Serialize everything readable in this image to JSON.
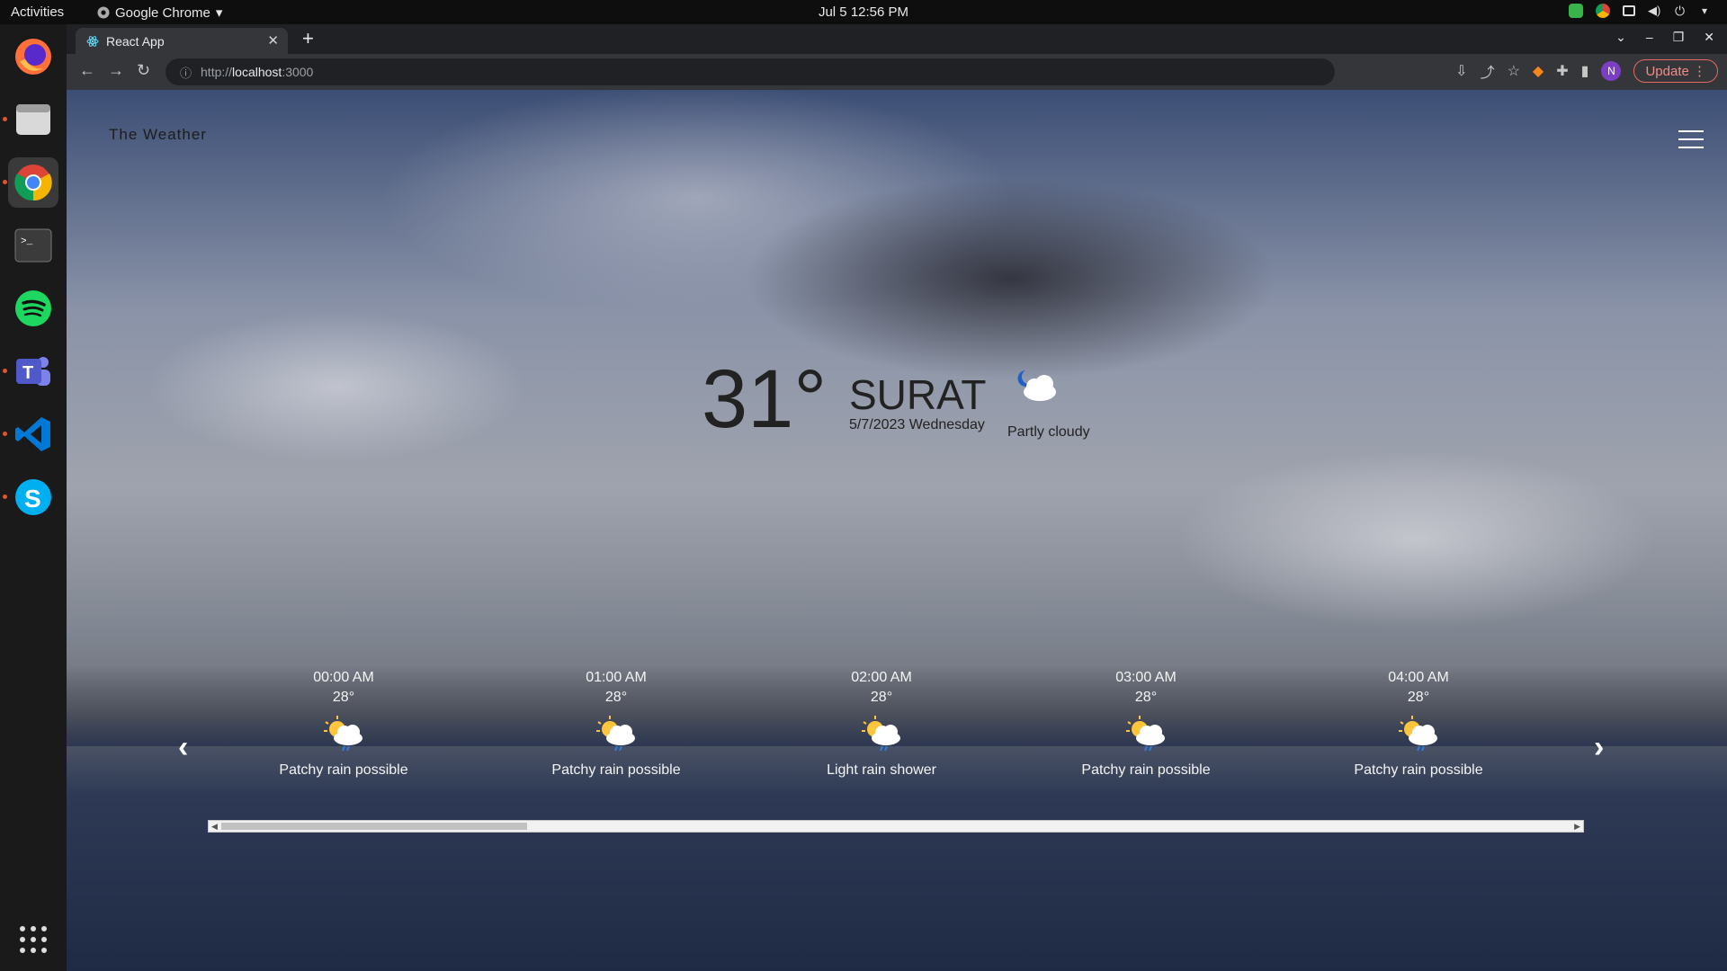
{
  "topbar": {
    "activities": "Activities",
    "app_name": "Google Chrome",
    "clock": "Jul 5  12:56 PM"
  },
  "dock": {
    "items": [
      "firefox-icon",
      "files-icon",
      "chrome-icon",
      "terminal-icon",
      "spotify-icon",
      "teams-icon",
      "vscode-icon",
      "skype-icon",
      "app-grid-icon"
    ]
  },
  "browser": {
    "tab_title": "React App",
    "url_prefix": "http://",
    "url_host": "localhost",
    "url_port": ":3000",
    "update_label": "Update",
    "avatar_letter": "N"
  },
  "app": {
    "logo": "The Weather",
    "current": {
      "temperature": "31°",
      "city": "SURAT",
      "date": "5/7/2023 Wednesday",
      "condition": "Partly cloudy"
    },
    "hourly": [
      {
        "time": "00:00 AM",
        "temp": "28°",
        "desc": "Patchy rain possible"
      },
      {
        "time": "01:00 AM",
        "temp": "28°",
        "desc": "Patchy rain possible"
      },
      {
        "time": "02:00 AM",
        "temp": "28°",
        "desc": "Light rain shower"
      },
      {
        "time": "03:00 AM",
        "temp": "28°",
        "desc": "Patchy rain possible"
      },
      {
        "time": "04:00 AM",
        "temp": "28°",
        "desc": "Patchy rain possible"
      }
    ]
  }
}
